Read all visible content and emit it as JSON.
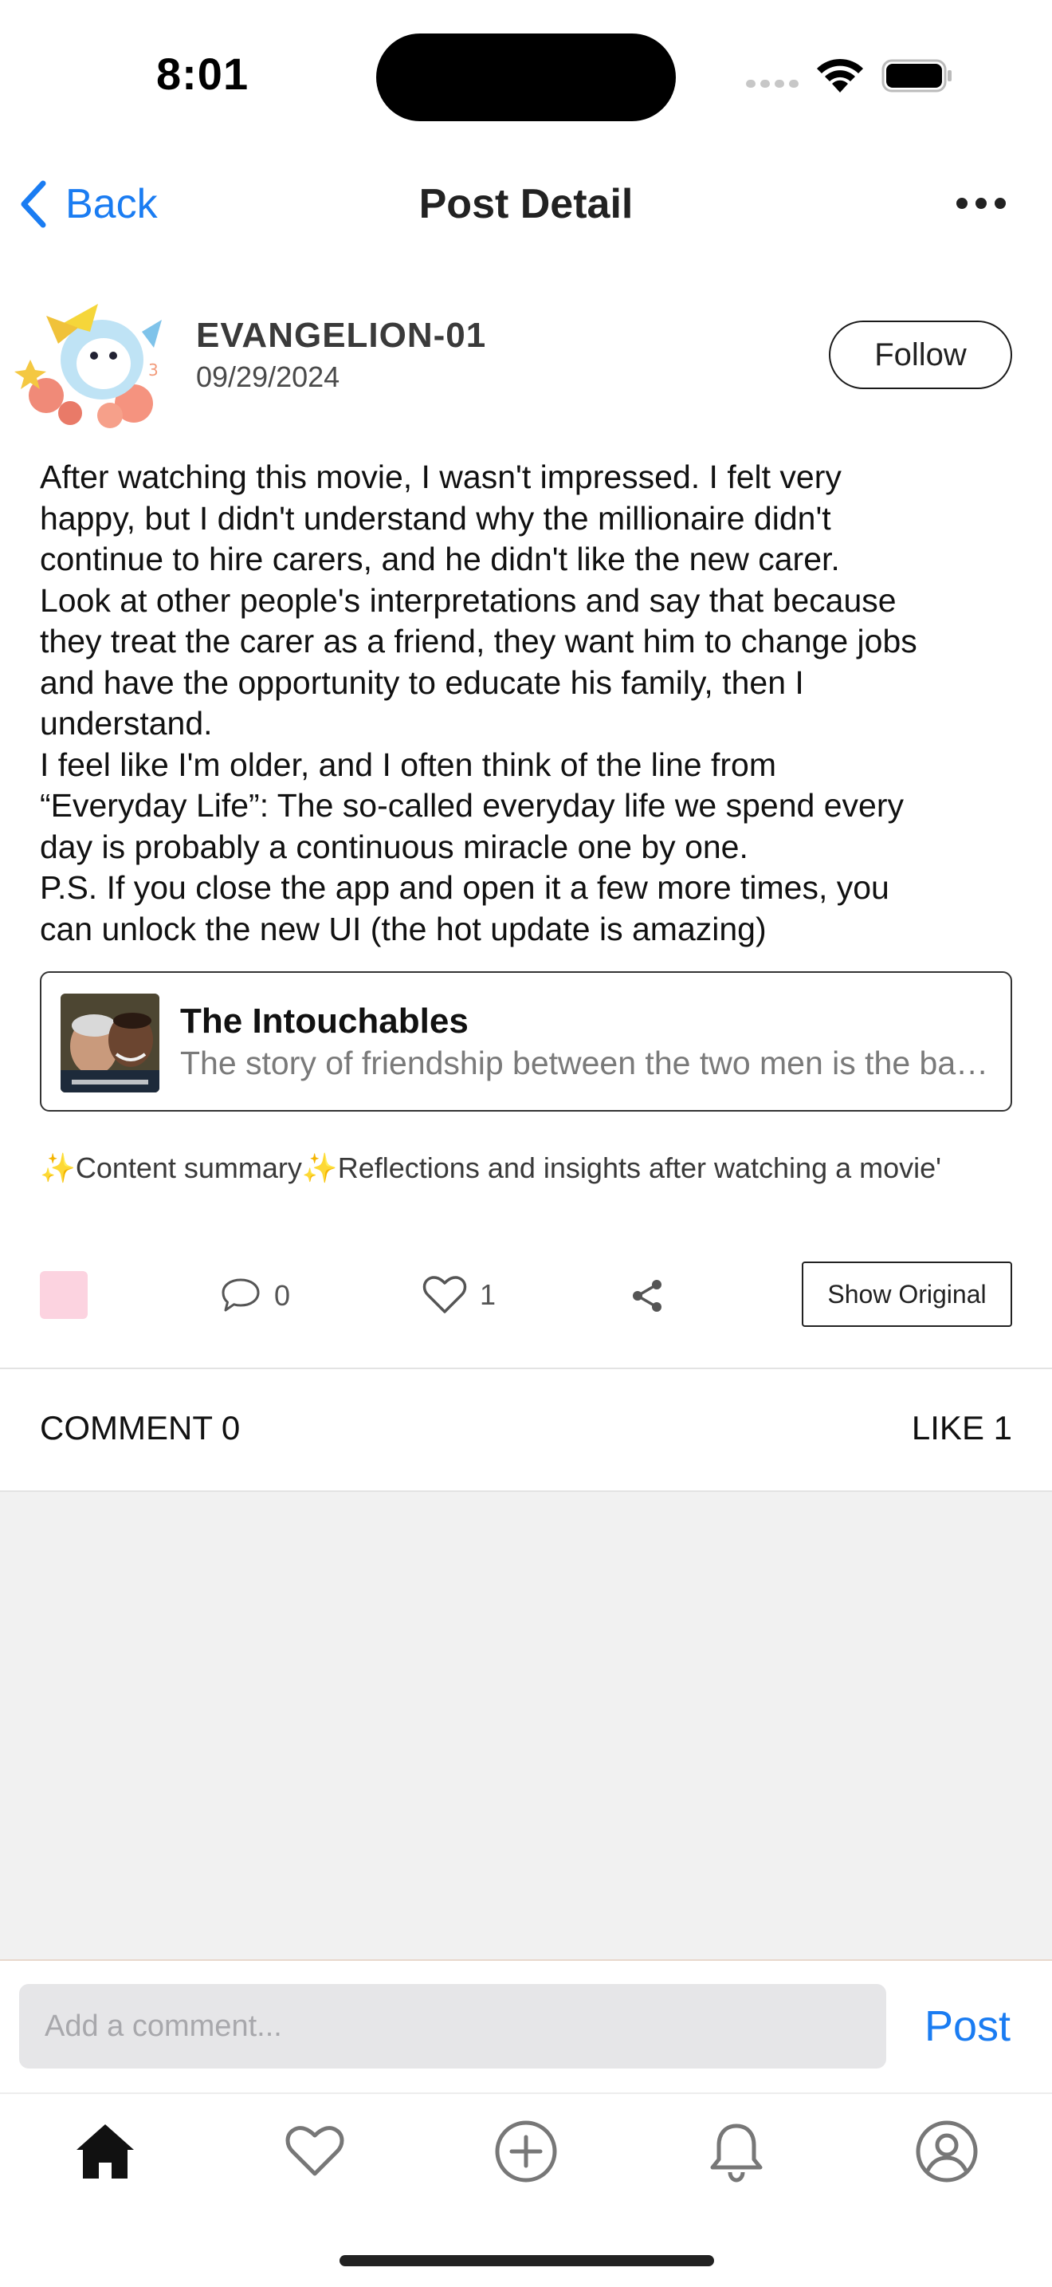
{
  "status_bar": {
    "time": "8:01"
  },
  "nav": {
    "back_label": "Back",
    "title": "Post Detail",
    "more_icon": "ellipsis-icon"
  },
  "post": {
    "author": "EVANGELION-01",
    "date": "09/29/2024",
    "follow_label": "Follow",
    "body_lines": [
      "After watching this movie, I wasn't impressed. I felt very",
      "happy, but I didn't understand why the millionaire didn't",
      "continue to hire carers, and he didn't like the new carer.",
      "Look at other people's interpretations and say that because",
      "they treat the carer as a friend, they want him to change jobs",
      "and have the opportunity to educate his family, then I",
      "understand.",
      "I feel like I'm older, and I often think of the line from",
      "“Everyday Life”: The so-called everyday life we spend every",
      "day is probably a continuous miracle one by one.",
      "P.S. If you close the app and open it a few more times, you",
      "can unlock the new UI (the hot update is amazing)"
    ],
    "movie": {
      "title": "The Intouchables",
      "description": "The story of friendship between the two men is the basis of this heartwarming film"
    },
    "summary": "✨Content summary✨Reflections and insights after watching a movie'",
    "tag_color": "#fcd3e0",
    "comment_count": "0",
    "like_count": "1",
    "show_original_label": "Show Original"
  },
  "counts": {
    "comment_label": "COMMENT 0",
    "like_label": "LIKE 1"
  },
  "comment_input": {
    "placeholder": "Add a comment...",
    "value": "",
    "post_label": "Post"
  },
  "tab_bar": {
    "items": [
      "home-icon",
      "heart-icon",
      "add-circle-icon",
      "bell-icon",
      "profile-icon"
    ]
  },
  "colors": {
    "accent": "#1a7cf2",
    "background_gray": "#f1f1f1"
  }
}
